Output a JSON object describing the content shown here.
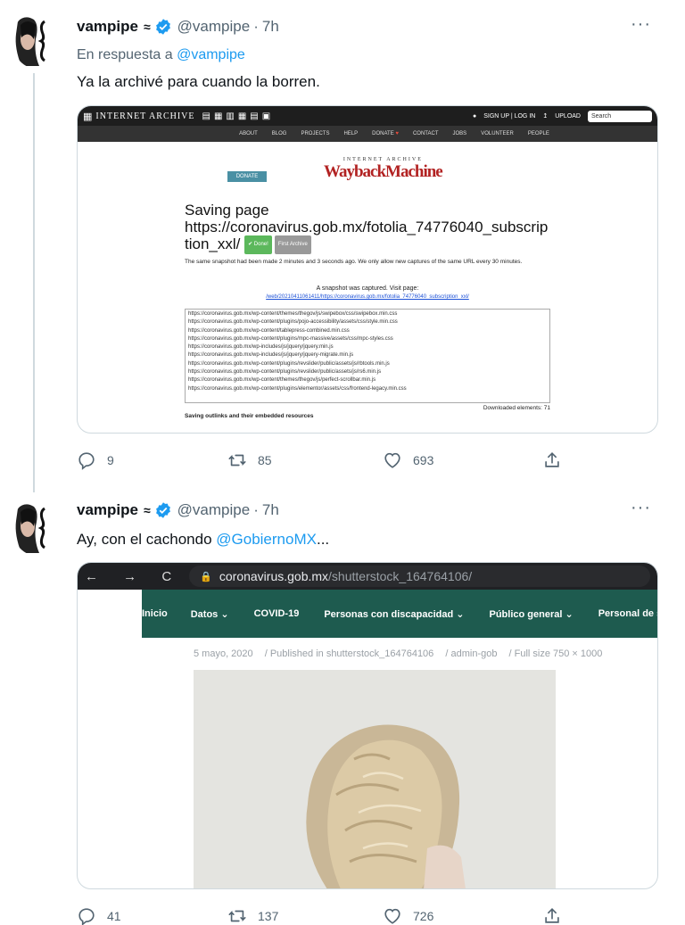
{
  "tweet1": {
    "name": "vampipe",
    "name_suffix": "≈",
    "handle": "@vampipe",
    "separator": "·",
    "time": "7h",
    "more": "···",
    "reply_prefix": "En respuesta a",
    "reply_mention": "@vampipe",
    "text": "Ya la archivé para cuando la borren.",
    "actions": {
      "replies": "9",
      "retweets": "85",
      "likes": "693"
    }
  },
  "wayback": {
    "ia_logo": "INTERNET ARCHIVE",
    "top_links": "SIGN UP | LOG IN",
    "upload": "UPLOAD",
    "search_placeholder": "Search",
    "nav": [
      "ABOUT",
      "BLOG",
      "PROJECTS",
      "HELP",
      "DONATE",
      "CONTACT",
      "JOBS",
      "VOLUNTEER",
      "PEOPLE"
    ],
    "donate_button": "DONATE",
    "logo_small": "INTERNET ARCHIVE",
    "logo_big": "WaybackMachine",
    "title_prefix": "Saving page",
    "title_url": "https://coronavirus.gob.mx/fotolia_74776040_subscription_xxl/",
    "done_badge": "✔ Done!",
    "first_badge": "First Archive",
    "message": "The same snapshot had been made 2 minutes and 3 seconds ago. We only allow new captures of the same URL every 30 minutes.",
    "captured": "A snapshot was captured. Visit page:",
    "captured_link": "/web/20210411061411/https://coronavirus.gob.mx/fotolia_74776040_subscription_xxl/",
    "resources": [
      "https://coronavirus.gob.mx/wp-content/themes/thegov/js/swipebox/css/swipebox.min.css",
      "https://coronavirus.gob.mx/wp-content/plugins/pojo-accessibility/assets/css/style.min.css",
      "https://coronavirus.gob.mx/wp-content/tablepress-combined.min.css",
      "https://coronavirus.gob.mx/wp-content/plugins/mpc-massive/assets/css/mpc-styles.css",
      "https://coronavirus.gob.mx/wp-includes/js/jquery/jquery.min.js",
      "https://coronavirus.gob.mx/wp-includes/js/jquery/jquery-migrate.min.js",
      "https://coronavirus.gob.mx/wp-content/plugins/revslider/public/assets/js/rbtools.min.js",
      "https://coronavirus.gob.mx/wp-content/plugins/revslider/public/assets/js/rs6.min.js",
      "https://coronavirus.gob.mx/wp-content/themes/thegov/js/perfect-scrollbar.min.js",
      "https://coronavirus.gob.mx/wp-content/plugins/elementor/assets/css/frontend-legacy.min.css"
    ],
    "downloaded": "Downloaded elements: 71",
    "saving": "Saving outlinks and their embedded resources"
  },
  "tweet2": {
    "name": "vampipe",
    "name_suffix": "≈",
    "handle": "@vampipe",
    "separator": "·",
    "time": "7h",
    "more": "···",
    "text_prefix": "Ay, con el cachondo",
    "text_mention": "@GobiernoMX",
    "text_suffix": "...",
    "actions": {
      "replies": "41",
      "retweets": "137",
      "likes": "726"
    }
  },
  "browser": {
    "nav_icons": "← → C",
    "url_host": "coronavirus.gob.mx",
    "url_path": "/shutterstock_164764106/",
    "menu": [
      "Inicio",
      "Datos ⌄",
      "COVID-19",
      "Personas con discapacidad ⌄",
      "Público general ⌄",
      "Personal de salud"
    ],
    "meta": [
      "5 mayo, 2020",
      "/ Published in shutterstock_164764106",
      "/ admin-gob",
      "/ Full size 750 × 1000"
    ]
  },
  "colors": {
    "accent": "#1d9bf0",
    "secondary_text": "#536471",
    "gob_green": "#1e5b4f"
  }
}
